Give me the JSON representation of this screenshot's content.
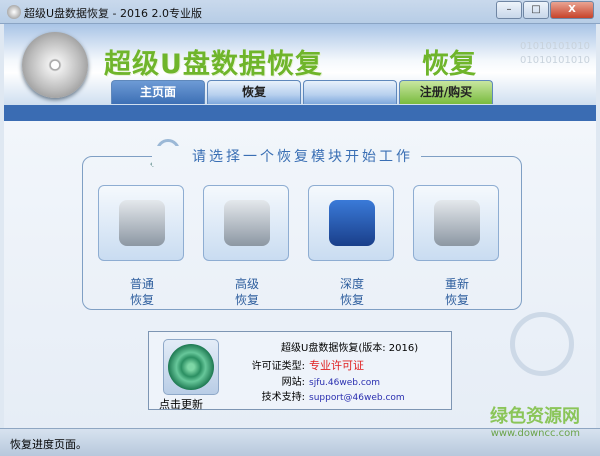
{
  "window": {
    "title": "超级U盘数据恢复 - 2016 2.0专业版",
    "minimize": "–",
    "maximize": "□",
    "close": "X"
  },
  "header": {
    "brand": "超级U盘数据恢复",
    "brand_fragment": "恢复",
    "binary": "01010101010"
  },
  "tabs": [
    {
      "label": "主页面",
      "active": true
    },
    {
      "label": "恢复"
    },
    {
      "label": ""
    },
    {
      "label": "注册/购买"
    }
  ],
  "main": {
    "prompt": "请选择一个恢复模块开始工作",
    "modules": [
      {
        "label1": "普通",
        "label2": "恢复",
        "icon": "recycle-bin-icon"
      },
      {
        "label1": "高级",
        "label2": "恢复",
        "icon": "drive-search-icon"
      },
      {
        "label1": "深度",
        "label2": "恢复",
        "icon": "monitor-search-icon"
      },
      {
        "label1": "重新",
        "label2": "恢复",
        "icon": "drive-clock-icon"
      }
    ]
  },
  "info": {
    "update_label": "点击更新",
    "title": "超级U盘数据恢复(版本: 2016)",
    "license_key": "许可证类型:",
    "license_value": "专业许可证",
    "site_key": "网站:",
    "site_value": "sjfu.46web.com",
    "support_key": "技术支持:",
    "support_value": "support@46web.com"
  },
  "status": "恢复进度页面。",
  "watermark": {
    "name": "绿色资源网",
    "url": "www.downcc.com"
  },
  "colors": {
    "accent": "#3a6cb3",
    "brand": "#6fb52b",
    "license": "#e02020",
    "link": "#2a2fb0"
  }
}
